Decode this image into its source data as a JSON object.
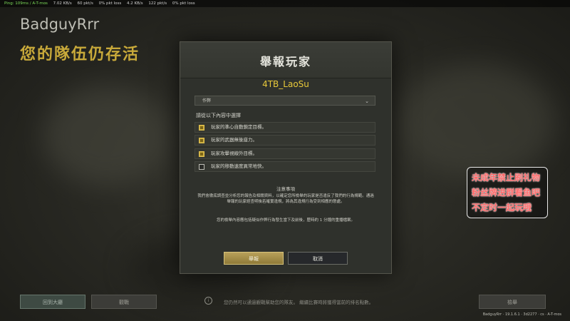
{
  "status_bar": {
    "ping": "Ping: 109ms / A-T-mos",
    "stat1": "7.02 KB/s",
    "stat2": "60 pkt/s",
    "stat3": "0% pkt loss",
    "stat4": "4.2 KB/s",
    "stat5": "122 pkt/s",
    "stat6": "0% pkt loss"
  },
  "player": {
    "name": "BadguyRrr",
    "team_status": "您的隊伍仍存活"
  },
  "dialog": {
    "title": "舉報玩家",
    "reported_player": "4TB_LaoSu",
    "category_selected": "作弊",
    "instruction": "請從以下內容中選擇",
    "reasons": [
      {
        "label": "玩家的準心自動鎖定目標。",
        "checked": true
      },
      {
        "label": "玩家的武器無後座力。",
        "checked": true
      },
      {
        "label": "玩家攻擊視線外目標。",
        "checked": true
      },
      {
        "label": "玩家的移動速度異常地快。",
        "checked": false
      }
    ],
    "notes_title": "注意事項",
    "notes_p1": "我們會徹底調查並分析您的報告及相關資料，以確定您所檢舉的玩家是否違反了我們的行為規範。通過舉報的玩家經查明後若確實違規，將為其違規行為受到相應的懲處。",
    "notes_p2": "您的檢舉內容應包括疑似作弊行為發生當下及前後，歷時約 1 分鐘的重播檔案。",
    "report_button": "舉報",
    "cancel_button": "取消"
  },
  "overlay_promo": {
    "line1": "未成年禁止刷礼物",
    "line2": "粉丝牌进群看鱼吧",
    "line3": "不定时一起玩哦"
  },
  "bottom_bar": {
    "lobby_button": "回到大廳",
    "spectate_button": "觀戰",
    "info_text": "您仍然可以通過觀戰幫助您的隊友。 繼續比賽時將獲得當前的排名點數。",
    "report_button": "檢舉",
    "version": "BadguyRrr · 19.1.6.1 · 3d2277 · cs · A-T-mos"
  },
  "colors": {
    "accent_gold": "#c8a93a",
    "player_yellow": "#e8c93a",
    "promo_red": "#ff6a6a"
  }
}
